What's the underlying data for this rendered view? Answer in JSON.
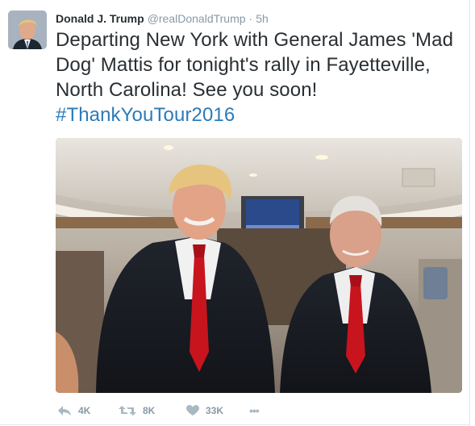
{
  "tweet": {
    "author": {
      "name": "Donald J. Trump",
      "handle": "@realDonaldTrump",
      "separator": "·",
      "time": "5h",
      "avatar": "profile-photo"
    },
    "text_main": "Departing New York with General James 'Mad Dog' Mattis for tonight's rally in Fayetteville, North Carolina! See you soon!",
    "hashtag": "#ThankYouTour2016",
    "media": "photo-two-men-on-airplane",
    "actions": {
      "reply_count": "4K",
      "retweet_count": "8K",
      "like_count": "33K",
      "more_label": "•••"
    }
  },
  "colors": {
    "text": "#292f33",
    "muted": "#8899a6",
    "link": "#2b7bb9",
    "action_icon": "#aab8c2"
  },
  "icons": {
    "reply": "reply-icon",
    "retweet": "retweet-icon",
    "like": "heart-icon",
    "more": "more-icon"
  }
}
